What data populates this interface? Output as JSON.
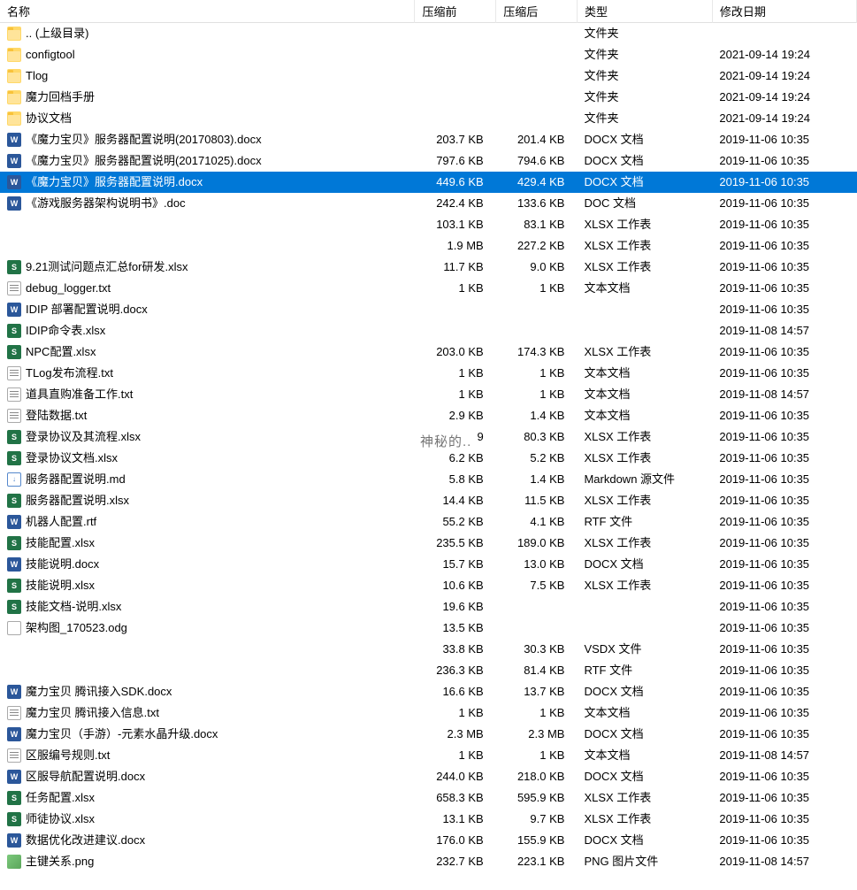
{
  "columns": {
    "name": "名称",
    "before": "压缩前",
    "after": "压缩后",
    "type": "类型",
    "date": "修改日期"
  },
  "watermark": "神秘的..",
  "files": [
    {
      "icon": "folder",
      "iconLabel": "",
      "name": ".. (上级目录)",
      "before": "",
      "after": "",
      "type": "文件夹",
      "date": "",
      "selected": false
    },
    {
      "icon": "folder",
      "iconLabel": "",
      "name": "configtool",
      "before": "",
      "after": "",
      "type": "文件夹",
      "date": "2021-09-14 19:24",
      "selected": false
    },
    {
      "icon": "folder",
      "iconLabel": "",
      "name": "Tlog",
      "before": "",
      "after": "",
      "type": "文件夹",
      "date": "2021-09-14 19:24",
      "selected": false
    },
    {
      "icon": "folder",
      "iconLabel": "",
      "name": "魔力回档手册",
      "before": "",
      "after": "",
      "type": "文件夹",
      "date": "2021-09-14 19:24",
      "selected": false
    },
    {
      "icon": "folder",
      "iconLabel": "",
      "name": "协议文档",
      "before": "",
      "after": "",
      "type": "文件夹",
      "date": "2021-09-14 19:24",
      "selected": false
    },
    {
      "icon": "docx",
      "iconLabel": "W",
      "name": "《魔力宝贝》服务器配置说明(20170803).docx",
      "before": "203.7 KB",
      "after": "201.4 KB",
      "type": "DOCX 文档",
      "date": "2019-11-06 10:35",
      "selected": false
    },
    {
      "icon": "docx",
      "iconLabel": "W",
      "name": "《魔力宝贝》服务器配置说明(20171025).docx",
      "before": "797.6 KB",
      "after": "794.6 KB",
      "type": "DOCX 文档",
      "date": "2019-11-06 10:35",
      "selected": false
    },
    {
      "icon": "docx",
      "iconLabel": "W",
      "name": "《魔力宝贝》服务器配置说明.docx",
      "before": "449.6 KB",
      "after": "429.4 KB",
      "type": "DOCX 文档",
      "date": "2019-11-06 10:35",
      "selected": true
    },
    {
      "icon": "doc",
      "iconLabel": "W",
      "name": "《游戏服务器架构说明书》.doc",
      "before": "242.4 KB",
      "after": "133.6 KB",
      "type": "DOC 文档",
      "date": "2019-11-06 10:35",
      "selected": false
    },
    {
      "icon": "none",
      "iconLabel": "",
      "name": "",
      "before": "103.1 KB",
      "after": "83.1 KB",
      "type": "XLSX 工作表",
      "date": "2019-11-06 10:35",
      "selected": false
    },
    {
      "icon": "none",
      "iconLabel": "",
      "name": "",
      "before": "1.9 MB",
      "after": "227.2 KB",
      "type": "XLSX 工作表",
      "date": "2019-11-06 10:35",
      "selected": false
    },
    {
      "icon": "xlsx",
      "iconLabel": "S",
      "name": "9.21测试问题点汇总for研发.xlsx",
      "before": "11.7 KB",
      "after": "9.0 KB",
      "type": "XLSX 工作表",
      "date": "2019-11-06 10:35",
      "selected": false
    },
    {
      "icon": "txt",
      "iconLabel": "",
      "name": "debug_logger.txt",
      "before": "1 KB",
      "after": "1 KB",
      "type": "文本文档",
      "date": "2019-11-06 10:35",
      "selected": false
    },
    {
      "icon": "docx",
      "iconLabel": "W",
      "name": "IDIP 部署配置说明.docx",
      "before": "",
      "after": "",
      "type": "",
      "date": "2019-11-06 10:35",
      "selected": false
    },
    {
      "icon": "xlsx",
      "iconLabel": "S",
      "name": "IDIP命令表.xlsx",
      "before": "",
      "after": "",
      "type": "",
      "date": "2019-11-08 14:57",
      "selected": false
    },
    {
      "icon": "xlsx",
      "iconLabel": "S",
      "name": "NPC配置.xlsx",
      "before": "203.0 KB",
      "after": "174.3 KB",
      "type": "XLSX 工作表",
      "date": "2019-11-06 10:35",
      "selected": false
    },
    {
      "icon": "txt",
      "iconLabel": "",
      "name": "TLog发布流程.txt",
      "before": "1 KB",
      "after": "1 KB",
      "type": "文本文档",
      "date": "2019-11-06 10:35",
      "selected": false
    },
    {
      "icon": "txt",
      "iconLabel": "",
      "name": "道具直购准备工作.txt",
      "before": "1 KB",
      "after": "1 KB",
      "type": "文本文档",
      "date": "2019-11-08 14:57",
      "selected": false
    },
    {
      "icon": "txt",
      "iconLabel": "",
      "name": "登陆数据.txt",
      "before": "2.9 KB",
      "after": "1.4 KB",
      "type": "文本文档",
      "date": "2019-11-06 10:35",
      "selected": false
    },
    {
      "icon": "xlsx",
      "iconLabel": "S",
      "name": "登录协议及其流程.xlsx",
      "before": "9",
      "after": "80.3 KB",
      "type": "XLSX 工作表",
      "date": "2019-11-06 10:35",
      "selected": false
    },
    {
      "icon": "xlsx",
      "iconLabel": "S",
      "name": "登录协议文档.xlsx",
      "before": "6.2 KB",
      "after": "5.2 KB",
      "type": "XLSX 工作表",
      "date": "2019-11-06 10:35",
      "selected": false
    },
    {
      "icon": "md",
      "iconLabel": "↓",
      "name": "服务器配置说明.md",
      "before": "5.8 KB",
      "after": "1.4 KB",
      "type": "Markdown 源文件",
      "date": "2019-11-06 10:35",
      "selected": false
    },
    {
      "icon": "xlsx",
      "iconLabel": "S",
      "name": "服务器配置说明.xlsx",
      "before": "14.4 KB",
      "after": "11.5 KB",
      "type": "XLSX 工作表",
      "date": "2019-11-06 10:35",
      "selected": false
    },
    {
      "icon": "rtf",
      "iconLabel": "W",
      "name": "机器人配置.rtf",
      "before": "55.2 KB",
      "after": "4.1 KB",
      "type": "RTF 文件",
      "date": "2019-11-06 10:35",
      "selected": false
    },
    {
      "icon": "xlsx",
      "iconLabel": "S",
      "name": "技能配置.xlsx",
      "before": "235.5 KB",
      "after": "189.0 KB",
      "type": "XLSX 工作表",
      "date": "2019-11-06 10:35",
      "selected": false
    },
    {
      "icon": "docx",
      "iconLabel": "W",
      "name": "技能说明.docx",
      "before": "15.7 KB",
      "after": "13.0 KB",
      "type": "DOCX 文档",
      "date": "2019-11-06 10:35",
      "selected": false
    },
    {
      "icon": "xlsx",
      "iconLabel": "S",
      "name": "技能说明.xlsx",
      "before": "10.6 KB",
      "after": "7.5 KB",
      "type": "XLSX 工作表",
      "date": "2019-11-06 10:35",
      "selected": false
    },
    {
      "icon": "xlsx",
      "iconLabel": "S",
      "name": "技能文档-说明.xlsx",
      "before": "19.6 KB",
      "after": "",
      "type": "",
      "date": "2019-11-06 10:35",
      "selected": false
    },
    {
      "icon": "odg",
      "iconLabel": "",
      "name": "架构图_170523.odg",
      "before": "13.5 KB",
      "after": "",
      "type": "",
      "date": "2019-11-06 10:35",
      "selected": false
    },
    {
      "icon": "none",
      "iconLabel": "",
      "name": "",
      "before": "33.8 KB",
      "after": "30.3 KB",
      "type": "VSDX 文件",
      "date": "2019-11-06 10:35",
      "selected": false
    },
    {
      "icon": "none",
      "iconLabel": "",
      "name": "",
      "before": "236.3 KB",
      "after": "81.4 KB",
      "type": "RTF 文件",
      "date": "2019-11-06 10:35",
      "selected": false
    },
    {
      "icon": "docx",
      "iconLabel": "W",
      "name": "魔力宝贝 腾讯接入SDK.docx",
      "before": "16.6 KB",
      "after": "13.7 KB",
      "type": "DOCX 文档",
      "date": "2019-11-06 10:35",
      "selected": false
    },
    {
      "icon": "txt",
      "iconLabel": "",
      "name": "魔力宝贝 腾讯接入信息.txt",
      "before": "1 KB",
      "after": "1 KB",
      "type": "文本文档",
      "date": "2019-11-06 10:35",
      "selected": false
    },
    {
      "icon": "docx",
      "iconLabel": "W",
      "name": "魔力宝贝（手游）-元素水晶升级.docx",
      "before": "2.3 MB",
      "after": "2.3 MB",
      "type": "DOCX 文档",
      "date": "2019-11-06 10:35",
      "selected": false
    },
    {
      "icon": "txt",
      "iconLabel": "",
      "name": "区服编号规则.txt",
      "before": "1 KB",
      "after": "1 KB",
      "type": "文本文档",
      "date": "2019-11-08 14:57",
      "selected": false
    },
    {
      "icon": "docx",
      "iconLabel": "W",
      "name": "区服导航配置说明.docx",
      "before": "244.0 KB",
      "after": "218.0 KB",
      "type": "DOCX 文档",
      "date": "2019-11-06 10:35",
      "selected": false
    },
    {
      "icon": "xlsx",
      "iconLabel": "S",
      "name": "任务配置.xlsx",
      "before": "658.3 KB",
      "after": "595.9 KB",
      "type": "XLSX 工作表",
      "date": "2019-11-06 10:35",
      "selected": false
    },
    {
      "icon": "xlsx",
      "iconLabel": "S",
      "name": "师徒协议.xlsx",
      "before": "13.1 KB",
      "after": "9.7 KB",
      "type": "XLSX 工作表",
      "date": "2019-11-06 10:35",
      "selected": false
    },
    {
      "icon": "docx",
      "iconLabel": "W",
      "name": "数据优化改进建议.docx",
      "before": "176.0 KB",
      "after": "155.9 KB",
      "type": "DOCX 文档",
      "date": "2019-11-06 10:35",
      "selected": false
    },
    {
      "icon": "png",
      "iconLabel": "",
      "name": "主键关系.png",
      "before": "232.7 KB",
      "after": "223.1 KB",
      "type": "PNG 图片文件",
      "date": "2019-11-08 14:57",
      "selected": false
    }
  ]
}
